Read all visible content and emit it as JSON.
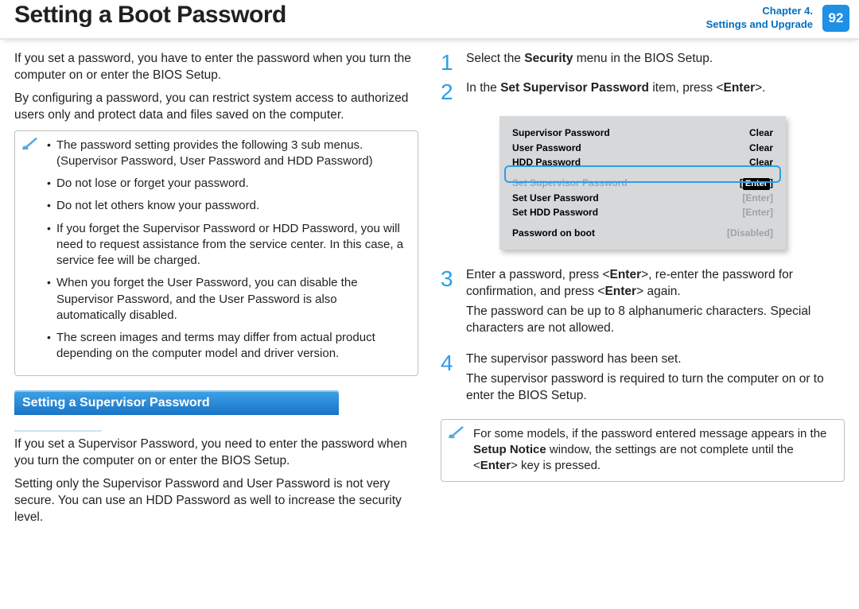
{
  "header": {
    "title": "Setting a Boot Password",
    "chapter_line1": "Chapter 4.",
    "chapter_line2": "Settings and Upgrade",
    "page_number": "92"
  },
  "left": {
    "intro1": "If you set a password, you have to enter the password when you turn the computer on or enter the BIOS Setup.",
    "intro2": "By configuring a password, you can restrict system access to authorized users only and protect data and files saved on the computer.",
    "notes": [
      "The password setting provides the following 3 sub menus. (Supervisor Password, User Password and HDD Password)",
      "Do not lose or forget your password.",
      "Do not let others know your password.",
      "If you forget the Supervisor Password or HDD Password, you will need to request assistance from the service center. In this case, a service fee will be charged.",
      "When you forget the User Password, you can disable the Supervisor Password, and the User Password is also automatically disabled.",
      "The screen images and terms may differ from actual product depending on the computer model and driver version."
    ],
    "section_title": "Setting a Supervisor Password",
    "section_p1": "If you set a Supervisor Password, you need to enter the password when you turn the computer on or enter the BIOS Setup.",
    "section_p2": "Setting only the Supervisor Password and User Password is not very secure. You can use an HDD Password as well to increase the security level."
  },
  "right": {
    "step1_pre": "Select the ",
    "step1_bold": "Security",
    "step1_post": " menu in the BIOS Setup.",
    "step2_pre": "In the ",
    "step2_bold": "Set Supervisor Password",
    "step2_mid": " item, press <",
    "step2_enter": "Enter",
    "step2_post": ">.",
    "bios": {
      "rows_top": [
        {
          "label": "Supervisor Password",
          "value": "Clear"
        },
        {
          "label": "User Password",
          "value": "Clear"
        },
        {
          "label": "HDD Password",
          "value": "Clear"
        }
      ],
      "rows_mid": [
        {
          "label": "Set Supervisor Password",
          "value": "[Enter]",
          "highlight": true
        },
        {
          "label": "Set User Password",
          "value": "[Enter]"
        },
        {
          "label": "Set HDD Password",
          "value": "[Enter]"
        }
      ],
      "rows_bot": [
        {
          "label": "Password on boot",
          "value": "[Disabled]"
        }
      ]
    },
    "step3_a_pre": "Enter a password, press <",
    "step3_a_b1": "Enter",
    "step3_a_mid": ">, re-enter the password for confirmation, and press <",
    "step3_a_b2": "Enter",
    "step3_a_post": "> again.",
    "step3_b": "The password can be up to 8 alphanumeric characters. Special characters are not allowed.",
    "step4_a": "The supervisor password has been set.",
    "step4_b": "The supervisor password is required to turn the computer on or to enter the BIOS Setup.",
    "note2_pre": "For some models, if the password entered message appears in the ",
    "note2_bold": "Setup Notice",
    "note2_mid": " window, the settings are not complete until the <",
    "note2_enter": "Enter",
    "note2_post": "> key is pressed."
  }
}
